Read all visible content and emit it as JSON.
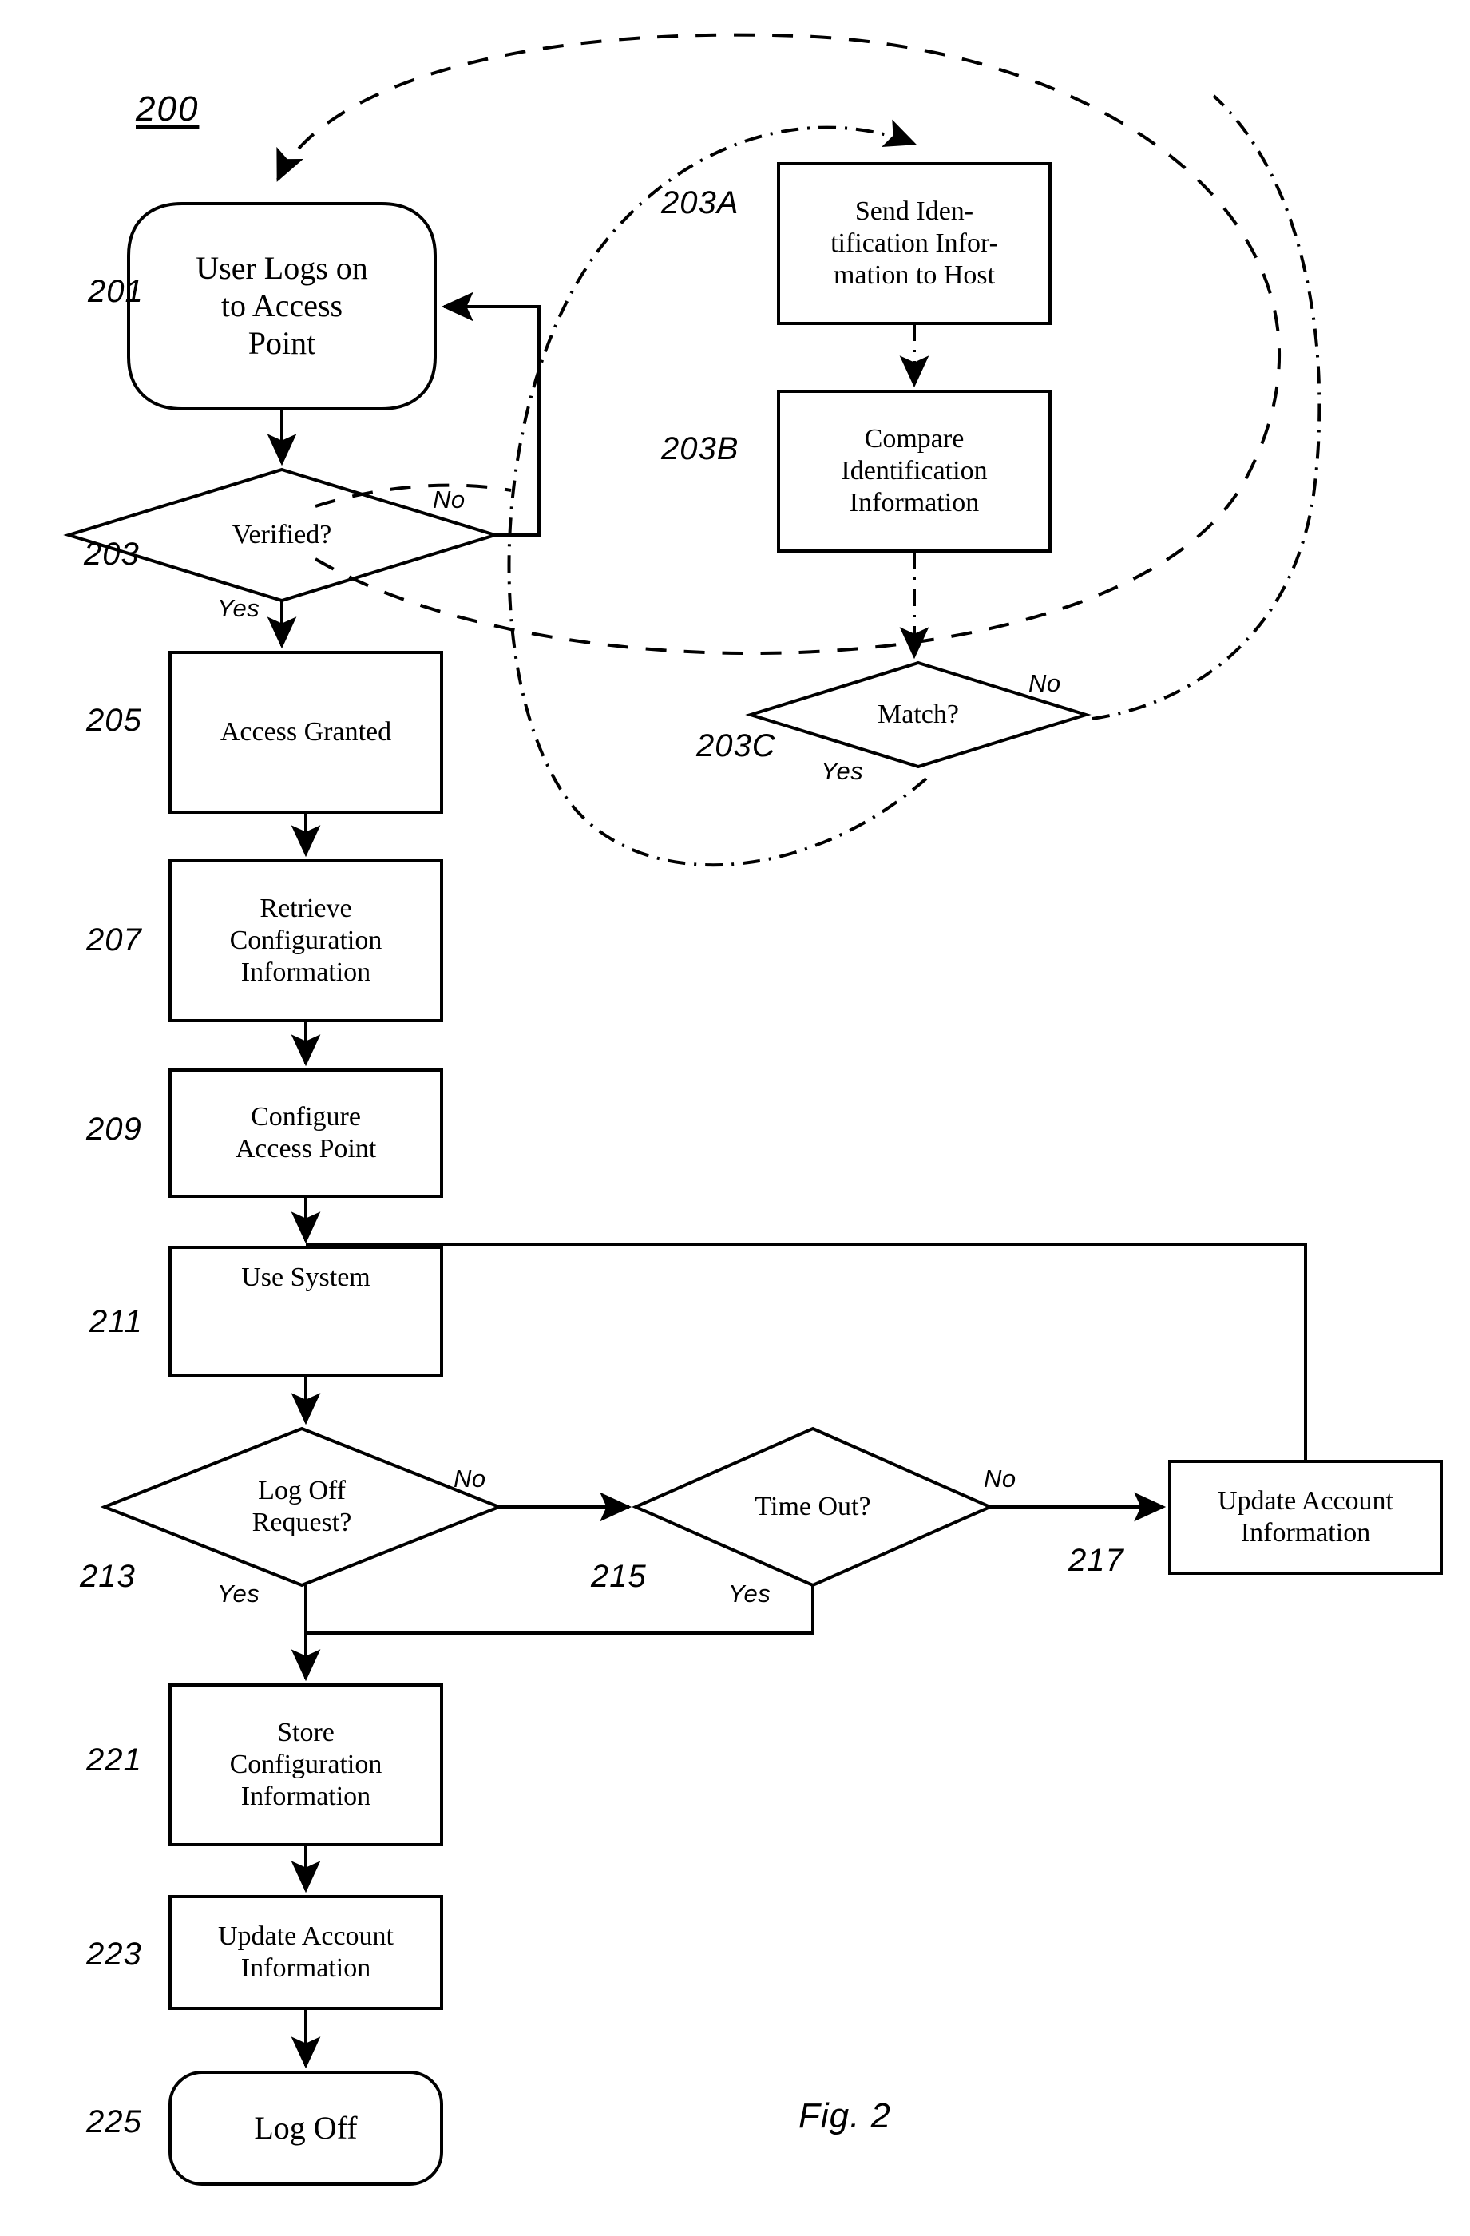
{
  "figure": {
    "id_label": "200",
    "caption": "Fig. 2",
    "title": "Access Point Login and Configuration Flowchart"
  },
  "nodes": [
    {
      "key": "n201",
      "ref": "201",
      "shape": "terminator",
      "text": "User Logs on\nto Access\nPoint"
    },
    {
      "key": "n203",
      "ref": "203",
      "shape": "decision",
      "text": "Verified?"
    },
    {
      "key": "n205",
      "ref": "205",
      "shape": "process",
      "text": "Access Granted"
    },
    {
      "key": "n207",
      "ref": "207",
      "shape": "process",
      "text": "Retrieve\nConfiguration\nInformation"
    },
    {
      "key": "n209",
      "ref": "209",
      "shape": "process",
      "text": "Configure\nAccess Point"
    },
    {
      "key": "n211",
      "ref": "211",
      "shape": "process",
      "text": "Use System"
    },
    {
      "key": "n213",
      "ref": "213",
      "shape": "decision",
      "text": "Log Off\nRequest?"
    },
    {
      "key": "n215",
      "ref": "215",
      "shape": "decision",
      "text": "Time Out?"
    },
    {
      "key": "n217",
      "ref": "217",
      "shape": "process",
      "text": "Update Account\nInformation"
    },
    {
      "key": "n221",
      "ref": "221",
      "shape": "process",
      "text": "Store\nConfiguration\nInformation"
    },
    {
      "key": "n223",
      "ref": "223",
      "shape": "process",
      "text": "Update Account\nInformation"
    },
    {
      "key": "n225",
      "ref": "225",
      "shape": "terminator",
      "text": "Log Off"
    },
    {
      "key": "n203A",
      "ref": "203A",
      "shape": "process",
      "text": "Send Iden-\ntification Infor-\nmation to Host"
    },
    {
      "key": "n203B",
      "ref": "203B",
      "shape": "process",
      "text": "Compare\nIdentification\nInformation"
    },
    {
      "key": "n203C",
      "ref": "203C",
      "shape": "decision",
      "text": "Match?"
    }
  ],
  "edge_labels": {
    "verified_no": "No",
    "verified_yes": "Yes",
    "match_no": "No",
    "match_yes": "Yes",
    "logoff_no": "No",
    "logoff_yes": "Yes",
    "timeout_no": "No",
    "timeout_yes": "Yes"
  },
  "node_text": {
    "n201": "User Logs on to Access Point",
    "n201_l1": "User Logs on",
    "n201_l2": "to Access",
    "n201_l3": "Point",
    "n203": "Verified?",
    "n205": "Access Granted",
    "n207_l1": "Retrieve",
    "n207_l2": "Configuration",
    "n207_l3": "Information",
    "n209_l1": "Configure",
    "n209_l2": "Access Point",
    "n211": "Use System",
    "n213_l1": "Log Off",
    "n213_l2": "Request?",
    "n215": "Time Out?",
    "n217_l1": "Update Account",
    "n217_l2": "Information",
    "n221_l1": "Store",
    "n221_l2": "Configuration",
    "n221_l3": "Information",
    "n223_l1": "Update Account",
    "n223_l2": "Information",
    "n225": "Log Off",
    "n203A_l1": "Send Iden-",
    "n203A_l2": "tification Infor-",
    "n203A_l3": "mation to Host",
    "n203B_l1": "Compare",
    "n203B_l2": "Identification",
    "n203B_l3": "Information",
    "n203C": "Match?"
  },
  "ref_numbers": {
    "r201": "201",
    "r203": "203",
    "r205": "205",
    "r207": "207",
    "r209": "209",
    "r211": "211",
    "r213": "213",
    "r215": "215",
    "r217": "217",
    "r221": "221",
    "r223": "223",
    "r225": "225",
    "r203A": "203A",
    "r203B": "203B",
    "r203C": "203C"
  },
  "colors": {
    "stroke": "#000000",
    "background": "#ffffff",
    "text": "#000000"
  }
}
